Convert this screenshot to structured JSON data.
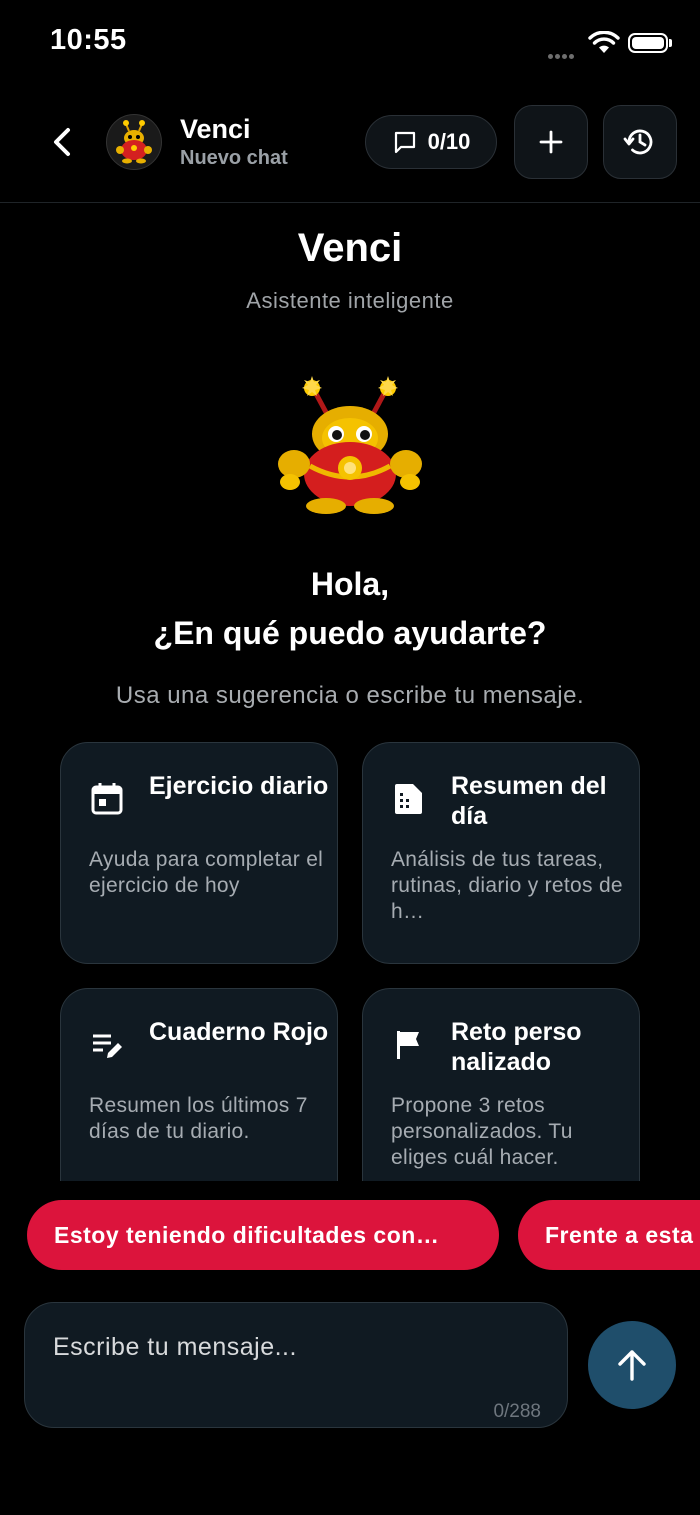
{
  "status_bar": {
    "time": "10:55"
  },
  "header": {
    "name": "Venci",
    "subtitle": "Nuevo chat",
    "counter": "0/10"
  },
  "main": {
    "title": "Venci",
    "subtitle": "Asistente inteligente",
    "greeting_line1": "Hola,",
    "greeting_line2": "¿En qué puedo ayudarte?",
    "hint": "Usa una sugerencia o escribe tu mensaje."
  },
  "cards": [
    {
      "icon": "calendar-icon",
      "title": "Ejercicio diario",
      "desc": "Ayuda para completar el ejercicio de hoy"
    },
    {
      "icon": "document-icon",
      "title": "Resumen del día",
      "desc": "Análisis de tus tareas, rutinas, diario y retos de h…"
    },
    {
      "icon": "edit-list-icon",
      "title": "Cuaderno Rojo",
      "desc": "Resumen los últimos 7 días de tu diario."
    },
    {
      "icon": "flag-icon",
      "title": "Reto perso nalizado",
      "desc": "Propone 3 retos personalizados. Tu eliges cuál hacer."
    }
  ],
  "chips": [
    "Estoy teniendo dificultades con…",
    "Frente a esta"
  ],
  "composer": {
    "placeholder": "Escribe tu mensaje...",
    "counter": "0/288"
  },
  "colors": {
    "background": "#000000",
    "card": "#101a22",
    "chip": "#dc143c",
    "send_button": "#1f4e6b"
  }
}
